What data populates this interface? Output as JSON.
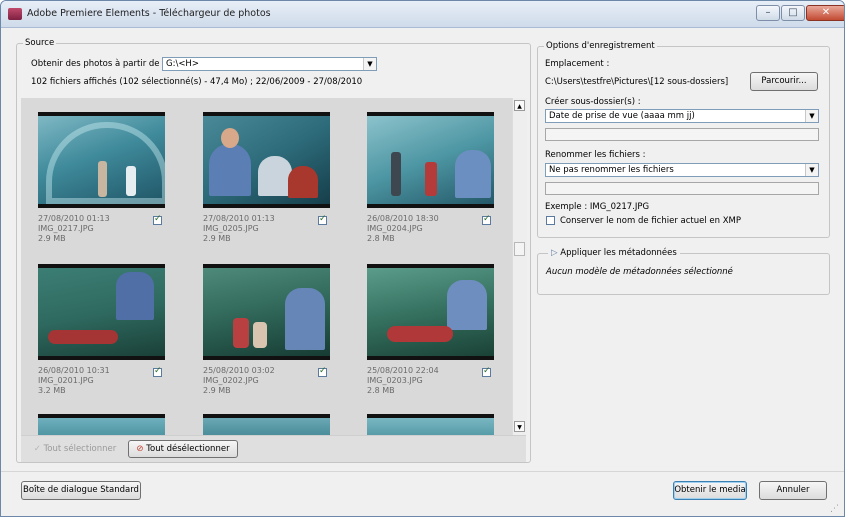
{
  "window": {
    "title": "Adobe Premiere Elements - Téléchargeur de photos"
  },
  "source": {
    "legend": "Source",
    "get_from_label": "Obtenir des photos à partir de :",
    "drive_value": "G:\\<H>",
    "summary": "102 fichiers affichés (102 sélectionné(s) - 47,4 Mo) ; 22/06/2009 - 27/08/2010"
  },
  "thumbnails": [
    {
      "date": "27/08/2010 01:13",
      "name": "IMG_0217.JPG",
      "size": "2.9 MB",
      "checked": true
    },
    {
      "date": "27/08/2010 01:13",
      "name": "IMG_0205.JPG",
      "size": "2.9 MB",
      "checked": true
    },
    {
      "date": "26/08/2010 18:30",
      "name": "IMG_0204.JPG",
      "size": "2.8 MB",
      "checked": true
    },
    {
      "date": "26/08/2010 10:31",
      "name": "IMG_0201.JPG",
      "size": "3.2 MB",
      "checked": true
    },
    {
      "date": "25/08/2010 03:02",
      "name": "IMG_0202.JPG",
      "size": "2.9 MB",
      "checked": true
    },
    {
      "date": "25/08/2010 22:04",
      "name": "IMG_0203.JPG",
      "size": "2.8 MB",
      "checked": true
    }
  ],
  "selection_buttons": {
    "select_all": "Tout sélectionner",
    "deselect_all": "Tout désélectionner"
  },
  "save_options": {
    "legend": "Options d'enregistrement",
    "location_label": "Emplacement :",
    "location_path": "C:\\Users\\testfre\\Pictures\\[12 sous-dossiers]",
    "browse_button": "Parcourir...",
    "subfolder_label": "Créer sous-dossier(s) :",
    "subfolder_value": "Date de prise de vue (aaaa mm jj)",
    "rename_label": "Renommer les fichiers :",
    "rename_value": "Ne pas renommer les fichiers",
    "example_label": "Exemple : IMG_0217.JPG",
    "keep_name_label": "Conserver le nom de fichier actuel en XMP"
  },
  "metadata": {
    "header": "Appliquer les métadonnées",
    "note": "Aucun modèle de métadonnées sélectionné"
  },
  "footer": {
    "standard_dialog": "Boîte de dialogue Standard",
    "get_media": "Obtenir le media",
    "cancel": "Annuler"
  }
}
